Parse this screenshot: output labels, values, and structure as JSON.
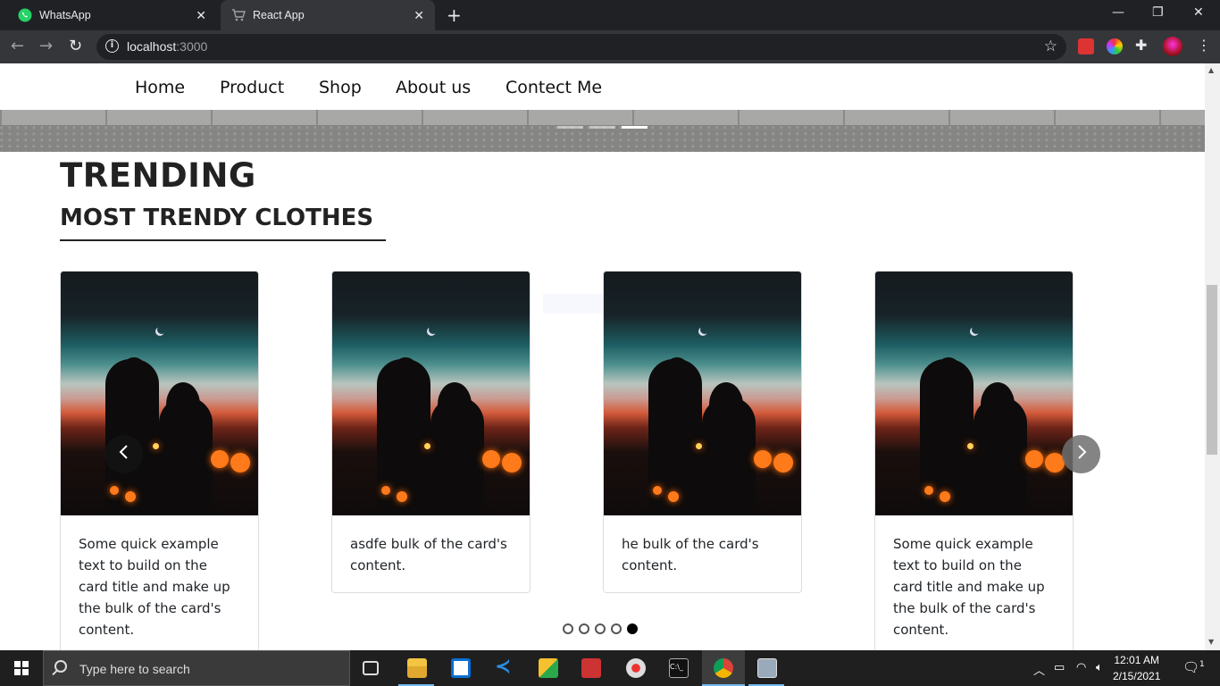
{
  "browser": {
    "tabs": [
      {
        "title": "WhatsApp",
        "icon": "whatsapp-icon",
        "active": false
      },
      {
        "title": "React App",
        "icon": "cart-icon",
        "active": true
      }
    ],
    "url_host": "localhost",
    "url_port": ":3000"
  },
  "nav": {
    "items": [
      "Home",
      "Product",
      "Shop",
      "About us",
      "Contect Me"
    ]
  },
  "carousel": {
    "slide_count": 3,
    "active_slide": 3
  },
  "section": {
    "title": "TRENDING",
    "subtitle": "MOST TRENDY CLOTHES"
  },
  "cards": [
    {
      "text": "Some quick example text to build on the card title and make up the bulk of the card's content."
    },
    {
      "text": "asdfe bulk of the card's content."
    },
    {
      "text": "he bulk of the card's content."
    },
    {
      "text": "Some quick example text to build on the card title and make up the bulk of the card's content."
    }
  ],
  "slider": {
    "dot_count": 5,
    "active_dot": 5,
    "prev_icon": "chevron-left-icon",
    "next_icon": "chevron-right-icon"
  },
  "taskbar": {
    "search_placeholder": "Type here to search",
    "time": "12:01 AM",
    "date": "2/15/2021",
    "notifications": "1"
  },
  "colors": {
    "nav_text": "#111111",
    "heading": "#222222",
    "active_dot": "#000000"
  }
}
